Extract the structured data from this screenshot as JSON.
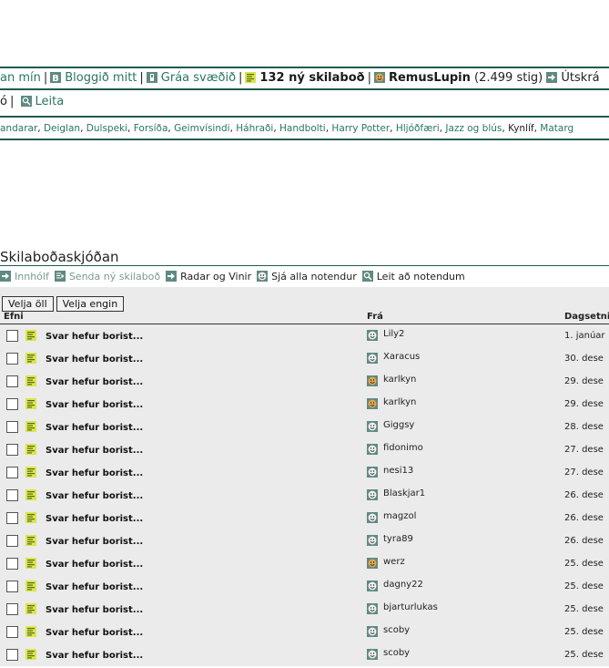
{
  "top_nav": {
    "items": [
      {
        "label": "an mín",
        "icon": "none",
        "style": "link"
      },
      {
        "label": "Bloggið mitt",
        "icon": "blog-icon",
        "style": "link"
      },
      {
        "label": "Gráa svæðið",
        "icon": "gray-area-icon",
        "style": "link"
      },
      {
        "label": "132 ný skilaboð",
        "icon": "message-icon",
        "style": "bold"
      },
      {
        "label": "RemusLupin",
        "icon": "user-icon",
        "style": "bold"
      },
      {
        "label": "(2.499 stig)",
        "icon": "none",
        "style": "plain"
      },
      {
        "label": "Útskrá",
        "icon": "logout-arrow-icon",
        "style": "plain"
      }
    ],
    "second_row_prefix": "ó",
    "search_label": "Leita"
  },
  "topics": [
    "andarar",
    "Deiglan",
    "Dulspeki",
    "Forsíða",
    "Geimvísindi",
    "Háhraði",
    "Handbolti",
    "Harry Potter",
    "Hljóðfæri",
    "Jazz og blús",
    "Kynlíf",
    "Matarg"
  ],
  "inbox": {
    "title": "Skilaboðaskjóðan",
    "toolbar": [
      {
        "label": "Innhólf",
        "icon": "arrow-icon",
        "style": "muted"
      },
      {
        "label": "Senda ný skilaboð",
        "icon": "send-icon",
        "style": "muted"
      },
      {
        "label": "Radar og Vinir",
        "icon": "arrow-icon",
        "style": "dark"
      },
      {
        "label": "Sjá alla notendur",
        "icon": "users-icon",
        "style": "dark"
      },
      {
        "label": "Leit að notendum",
        "icon": "search-icon",
        "style": "dark"
      }
    ],
    "select_all_label": "Velja öll",
    "select_none_label": "Velja engin",
    "columns": {
      "subject": "Efni",
      "from": "Frá",
      "date": "Dagsetni"
    },
    "messages": [
      {
        "subject": "Svar hefur borist...",
        "from": "Lily2",
        "date": "1. janúar",
        "avatar": "plain"
      },
      {
        "subject": "Svar hefur borist...",
        "from": "Xaracus",
        "date": "30. dese",
        "avatar": "plain"
      },
      {
        "subject": "Svar hefur borist...",
        "from": "karlkyn",
        "date": "29. dese",
        "avatar": "orange"
      },
      {
        "subject": "Svar hefur borist...",
        "from": "karlkyn",
        "date": "29. dese",
        "avatar": "orange"
      },
      {
        "subject": "Svar hefur borist...",
        "from": "Giggsy",
        "date": "28. dese",
        "avatar": "plain"
      },
      {
        "subject": "Svar hefur borist...",
        "from": "fidonimo",
        "date": "27. dese",
        "avatar": "plain"
      },
      {
        "subject": "Svar hefur borist...",
        "from": "nesi13",
        "date": "27. dese",
        "avatar": "plain"
      },
      {
        "subject": "Svar hefur borist...",
        "from": "Blaskjar1",
        "date": "26. dese",
        "avatar": "plain"
      },
      {
        "subject": "Svar hefur borist...",
        "from": "magzol",
        "date": "26. dese",
        "avatar": "plain"
      },
      {
        "subject": "Svar hefur borist...",
        "from": "tyra89",
        "date": "26. dese",
        "avatar": "plain"
      },
      {
        "subject": "Svar hefur borist...",
        "from": "werz",
        "date": "25. dese",
        "avatar": "orange"
      },
      {
        "subject": "Svar hefur borist...",
        "from": "dagny22",
        "date": "25. dese",
        "avatar": "plain"
      },
      {
        "subject": "Svar hefur borist...",
        "from": "bjarturlukas",
        "date": "25. dese",
        "avatar": "plain"
      },
      {
        "subject": "Svar hefur borist...",
        "from": "scoby",
        "date": "25. dese",
        "avatar": "plain"
      },
      {
        "subject": "Svar hefur borist...",
        "from": "scoby",
        "date": "25. dese",
        "avatar": "plain"
      }
    ]
  },
  "colors": {
    "accent": "#2a7564",
    "rule": "#1e5a50",
    "icon_bg": "#5f8a82",
    "message_icon": "#d9e64a",
    "row_bg": "#ebebeb"
  }
}
